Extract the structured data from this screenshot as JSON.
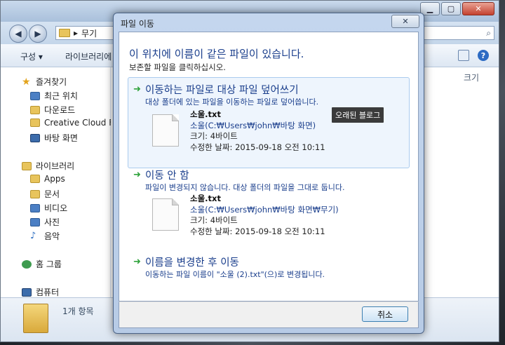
{
  "explorer": {
    "address": "무기",
    "toolbar": {
      "organize": "구성",
      "library": "라이브러리에"
    },
    "column_header": "크기",
    "status": "1개 항목",
    "sidebar": [
      {
        "label": "즐겨찾기",
        "icon": "star-icon"
      },
      {
        "label": "최근 위치",
        "icon": "recent-places-icon"
      },
      {
        "label": "다운로드",
        "icon": "downloads-folder-icon"
      },
      {
        "label": "Creative Cloud F",
        "icon": "folder-icon"
      },
      {
        "label": "바탕 화면",
        "icon": "desktop-icon"
      },
      {
        "label": "라이브러리",
        "icon": "library-icon"
      },
      {
        "label": "Apps",
        "icon": "folder-icon"
      },
      {
        "label": "문서",
        "icon": "documents-icon"
      },
      {
        "label": "비디오",
        "icon": "videos-icon"
      },
      {
        "label": "사진",
        "icon": "pictures-icon"
      },
      {
        "label": "음악",
        "icon": "music-icon"
      },
      {
        "label": "홈 그룹",
        "icon": "homegroup-icon"
      },
      {
        "label": "컴퓨터",
        "icon": "computer-icon"
      }
    ]
  },
  "dialog": {
    "title": "파일 이동",
    "close": "✕",
    "headline": "이 위치에 이름이 같은 파일이 있습니다.",
    "subline": "보존할 파일을 클릭하십시오.",
    "options": [
      {
        "title": "이동하는 파일로 대상 파일 덮어쓰기",
        "desc": "대상 폴더에 있는 파일을 이동하는 파일로 덮어씁니다.",
        "file": {
          "name": "소울.txt",
          "path": "소울(C:₩Users₩john₩바탕 화면)",
          "size": "크기: 4바이트",
          "modified": "수정한 날짜: 2015-09-18 오전 10:11"
        }
      },
      {
        "title": "이동 안 함",
        "desc": "파일이 변경되지 않습니다. 대상 폴더의 파일을 그대로 둡니다.",
        "file": {
          "name": "소울.txt",
          "path": "소울(C:₩Users₩john₩바탕 화면₩무기)",
          "size": "크기: 4바이트",
          "modified": "수정한 날짜: 2015-09-18 오전 10:11"
        }
      },
      {
        "title": "이름을 변경한 후 이동",
        "desc": "이동하는 파일 이름이 \"소울 (2).txt\"(으)로 변경됩니다."
      }
    ],
    "watermark": "오래된 블로그",
    "cancel": "취소"
  }
}
